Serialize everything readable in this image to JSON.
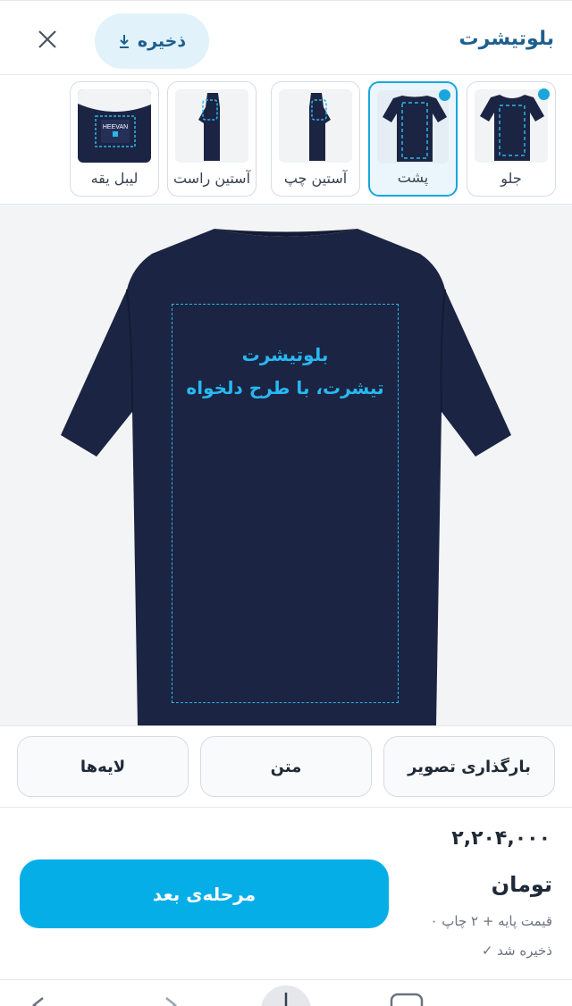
{
  "header": {
    "title": "بلوتیشرت",
    "save_label": "ذخیره",
    "icons": {
      "save": "download-icon",
      "close": "close-icon"
    }
  },
  "views": [
    {
      "label": "جلو",
      "has_design": true,
      "active": false
    },
    {
      "label": "پشت",
      "has_design": true,
      "active": true
    },
    {
      "label": "آستین چپ",
      "has_design": false,
      "active": false
    },
    {
      "label": "آستین راست",
      "has_design": false,
      "active": false
    },
    {
      "label": "لیبل یقه",
      "has_design": false,
      "active": false
    }
  ],
  "canvas": {
    "design_text_line1": "بلوتیشرت",
    "design_text_line2": "تیشرت، با طرح دلخواه",
    "label_thumb_text": "HEEVAN",
    "shirt_color": "#1b2442",
    "print_area_color": "#2cb5eb"
  },
  "tools": {
    "upload_label": "بارگذاری تصویر",
    "text_label": "متن",
    "layers_label": "لایه‌ها"
  },
  "footer": {
    "price": "۲,۲۰۴,۰۰۰",
    "currency": "تومان",
    "price_note": "قیمت پایه + ۲ چاپ ۰",
    "saved_note": "ذخیره شد ✓",
    "next_label": "مرحله‌ی بعد"
  },
  "colors": {
    "accent": "#06aee8",
    "brand_text": "#1d5f8e",
    "active_tab_bg": "#eaf6fc"
  }
}
